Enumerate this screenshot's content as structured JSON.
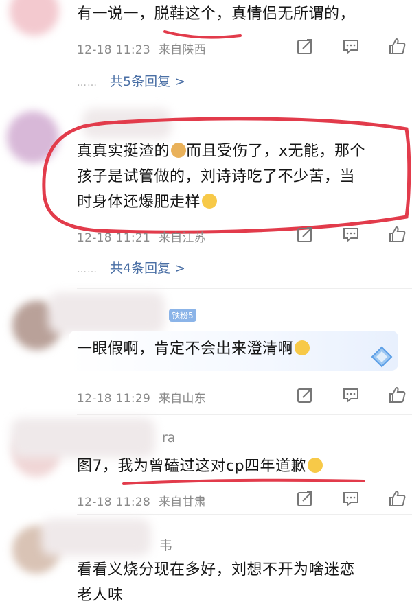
{
  "comments": [
    {
      "text_lines": [
        "有一说一，脱鞋这个，真情侣无所谓的，"
      ],
      "time": "12-18 11:23",
      "location": "来自陕西",
      "replies": "共5条回复 >"
    },
    {
      "text_lines": [
        "真真实挺渣的",
        "而且受伤了，x无能，那个",
        "孩子是试管做的，刘诗诗吃了不少苦，当",
        "时身体还爆肥走样"
      ],
      "time": "12-18 11:21",
      "location": "来自江苏",
      "replies": "共4条回复 >"
    },
    {
      "badge": "铁粉5",
      "text_lines": [
        "一眼假啊，肯定不会出来澄清啊"
      ],
      "time": "12-18 11:29",
      "location": "来自山东"
    },
    {
      "name_fragment": "ra",
      "text_lines": [
        "图7，我为曾磕过这对cp四年道歉"
      ],
      "time": "12-18 11:28",
      "location": "来自甘肃"
    },
    {
      "name_fragment": "韦",
      "text_lines": [
        "看看义烧分现在多好，刘想不开为啥迷恋",
        "老人味"
      ]
    }
  ],
  "reply_dots": "……",
  "icons": [
    "share-icon",
    "comment-icon",
    "like-icon"
  ],
  "colors": {
    "annotation_red": "#e23b4b",
    "link_blue": "#4a6fa5",
    "meta_gray": "#8a8a8a"
  }
}
